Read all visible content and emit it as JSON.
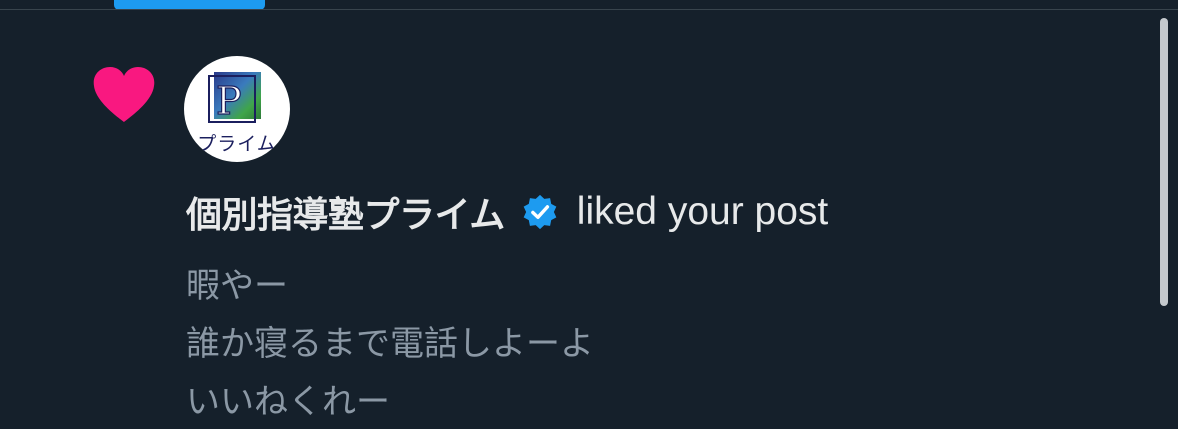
{
  "tabs": {
    "active_indicator_color": "#1d9bf0"
  },
  "notification": {
    "type": "like",
    "icon": "heart-icon",
    "icon_color": "#f91880",
    "actor": {
      "name": "個別指導塾プライム",
      "verified": true,
      "verified_icon": "verified-badge-icon",
      "verified_color": "#1d9bf0",
      "avatar_text": "プライム",
      "avatar_logo_letter": "P"
    },
    "action_text": "liked your post",
    "post_lines": [
      "暇やー",
      "誰か寝るまで電話しよーよ",
      "いいねくれー"
    ]
  },
  "theme": {
    "background": "#15202b",
    "primary_text": "#e7e9ea",
    "secondary_text": "#8b98a5"
  }
}
